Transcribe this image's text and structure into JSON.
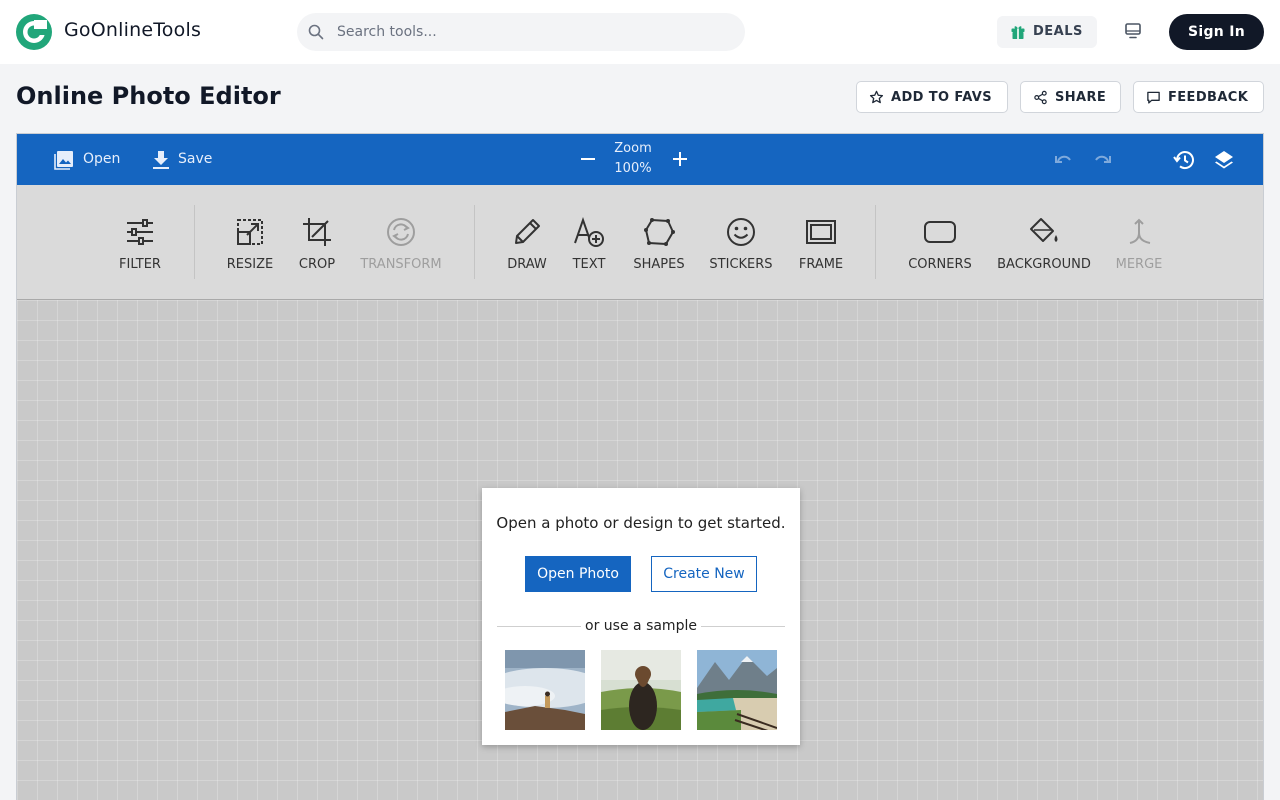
{
  "header": {
    "brand": "GoOnlineTools",
    "search_placeholder": "Search tools...",
    "deals_label": "DEALS",
    "signin_label": "Sign In",
    "icons": [
      "logo-icon",
      "search-icon",
      "gift-icon",
      "monitor-icon"
    ]
  },
  "page": {
    "title": "Online Photo Editor",
    "actions": [
      {
        "label": "ADD TO FAVS",
        "icon": "star-icon"
      },
      {
        "label": "SHARE",
        "icon": "share-icon"
      },
      {
        "label": "FEEDBACK",
        "icon": "message-icon"
      }
    ]
  },
  "editor": {
    "topbar": {
      "open_label": "Open",
      "save_label": "Save",
      "zoom_label": "Zoom",
      "zoom_value": "100%",
      "icons": [
        "image-icon",
        "download-icon",
        "minus-icon",
        "plus-icon",
        "undo-icon",
        "redo-icon",
        "history-icon",
        "layers-icon"
      ]
    },
    "tools": [
      {
        "label": "FILTER",
        "icon": "sliders-icon",
        "enabled": true
      },
      {
        "label": "RESIZE",
        "icon": "resize-icon",
        "enabled": true
      },
      {
        "label": "CROP",
        "icon": "crop-icon",
        "enabled": true
      },
      {
        "label": "TRANSFORM",
        "icon": "rotate-icon",
        "enabled": false
      },
      {
        "label": "DRAW",
        "icon": "pencil-icon",
        "enabled": true
      },
      {
        "label": "TEXT",
        "icon": "text-add-icon",
        "enabled": true
      },
      {
        "label": "SHAPES",
        "icon": "shape-icon",
        "enabled": true
      },
      {
        "label": "STICKERS",
        "icon": "smiley-icon",
        "enabled": true
      },
      {
        "label": "FRAME",
        "icon": "frame-icon",
        "enabled": true
      },
      {
        "label": "CORNERS",
        "icon": "rounded-rect-icon",
        "enabled": true
      },
      {
        "label": "BACKGROUND",
        "icon": "paint-bucket-icon",
        "enabled": true
      },
      {
        "label": "MERGE",
        "icon": "merge-icon",
        "enabled": false
      }
    ],
    "dialog": {
      "message": "Open a photo or design to get started.",
      "open_photo_label": "Open Photo",
      "create_new_label": "Create New",
      "sample_text": "or use a sample"
    }
  },
  "colors": {
    "accent": "#1565c0",
    "logo": "#21a67a",
    "signin_bg": "#111827",
    "toolbar_bg": "#dadada",
    "canvas_bg": "#c9c9c9"
  }
}
